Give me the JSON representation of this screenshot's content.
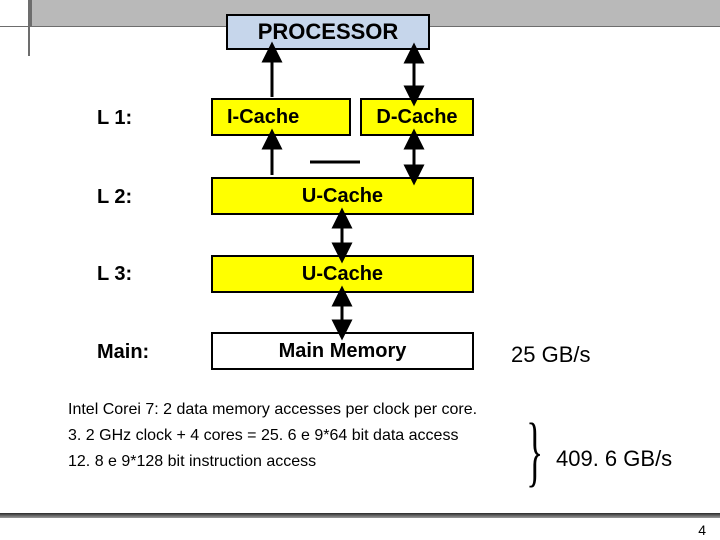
{
  "processor": "PROCESSOR",
  "labels": {
    "l1": "L 1:",
    "l2": "L 2:",
    "l3": "L 3:",
    "main": "Main:"
  },
  "boxes": {
    "icache": "I-Cache",
    "dcache": "D-Cache",
    "l2": "U-Cache",
    "l3": "U-Cache",
    "main": "Main Memory"
  },
  "bandwidth": {
    "main": "25 GB/s",
    "total": "409. 6 GB/s"
  },
  "notes": {
    "line1": "Intel Corei 7: 2 data memory accesses per clock per core.",
    "line2": "3. 2 GHz clock + 4 cores = 25. 6 e 9*64 bit data access",
    "line3": "12. 8 e 9*128 bit instruction access"
  },
  "page": "4",
  "chart_data": {
    "type": "diagram",
    "title": "Memory hierarchy bandwidths",
    "levels": [
      {
        "level": "Processor",
        "caches": [
          "PROCESSOR"
        ]
      },
      {
        "level": "L1",
        "caches": [
          "I-Cache",
          "D-Cache"
        ]
      },
      {
        "level": "L2",
        "caches": [
          "U-Cache"
        ]
      },
      {
        "level": "L3",
        "caches": [
          "U-Cache"
        ]
      },
      {
        "level": "Main",
        "caches": [
          "Main Memory"
        ],
        "bandwidth_gbs": 25
      }
    ],
    "derived_total_bandwidth_gbs": 409.6,
    "cpu": "Intel Core i7",
    "clock_ghz": 3.2,
    "cores": 4,
    "data_accesses_per_clock_per_core": 2,
    "data_access_rate": "25.6e9 * 64 bit",
    "instruction_access_rate": "12.8e9 * 128 bit"
  }
}
